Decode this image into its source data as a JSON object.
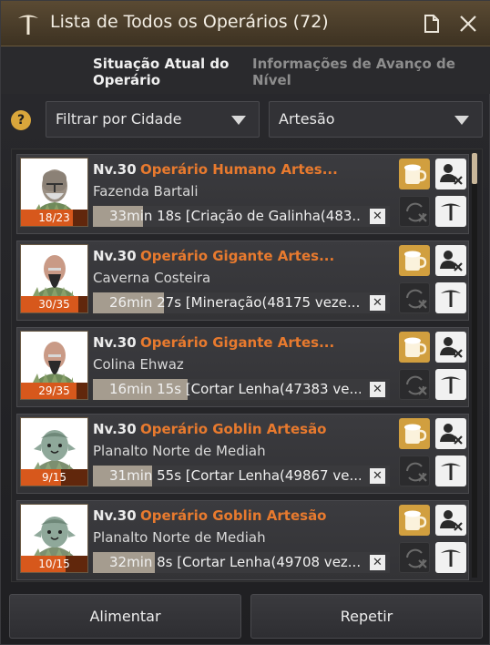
{
  "window": {
    "title": "Lista de Todos os Operários (72)"
  },
  "tabs": [
    {
      "label": "Situação Atual do Operário",
      "active": true
    },
    {
      "label": "Informações de Avanço de Nível",
      "active": false
    }
  ],
  "filters": {
    "help_icon": "?",
    "city": {
      "label": "Filtrar por Cidade"
    },
    "type": {
      "label": "Artesão"
    }
  },
  "scroll": {
    "position_fraction": 0.0
  },
  "workers": [
    {
      "level": "Nv.30",
      "name": "Operário Humano Artes...",
      "location": "Fazenda Bartali",
      "stamina": "18/23",
      "stamina_fraction": 0.78,
      "task": "33min 18s [Criação de Galinha(483...",
      "task_progress": 0.17,
      "race": "human"
    },
    {
      "level": "Nv.30",
      "name": "Operário Gigante Artes...",
      "location": "Caverna Costeira",
      "stamina": "30/35",
      "stamina_fraction": 0.86,
      "task": "26min 27s [Mineração(48175 veze...",
      "task_progress": 0.24,
      "race": "giant"
    },
    {
      "level": "Nv.30",
      "name": "Operário Gigante Artes...",
      "location": "Colina Ehwaz",
      "stamina": "29/35",
      "stamina_fraction": 0.83,
      "task": "16min 15s [Cortar Lenha(47383 ve...",
      "task_progress": 0.32,
      "race": "giant"
    },
    {
      "level": "Nv.30",
      "name": "Operário Goblin Artesão",
      "location": "Planalto Norte de Mediah",
      "stamina": "9/15",
      "stamina_fraction": 0.6,
      "task": "31min 55s [Cortar Lenha(49867 ve...",
      "task_progress": 0.2,
      "race": "goblin"
    },
    {
      "level": "Nv.30",
      "name": "Operário Goblin Artesão",
      "location": "Planalto Norte de Mediah",
      "stamina": "10/15",
      "stamina_fraction": 0.67,
      "task": "32min 8s [Cortar Lenha(49708 vez...",
      "task_progress": 0.21,
      "race": "goblin"
    }
  ],
  "footer": {
    "feed_label": "Alimentar",
    "repeat_label": "Repetir"
  },
  "colors": {
    "accent": "#e87a2e",
    "feed_button": "#d19f3f",
    "stamina_band": "#d7581c"
  }
}
